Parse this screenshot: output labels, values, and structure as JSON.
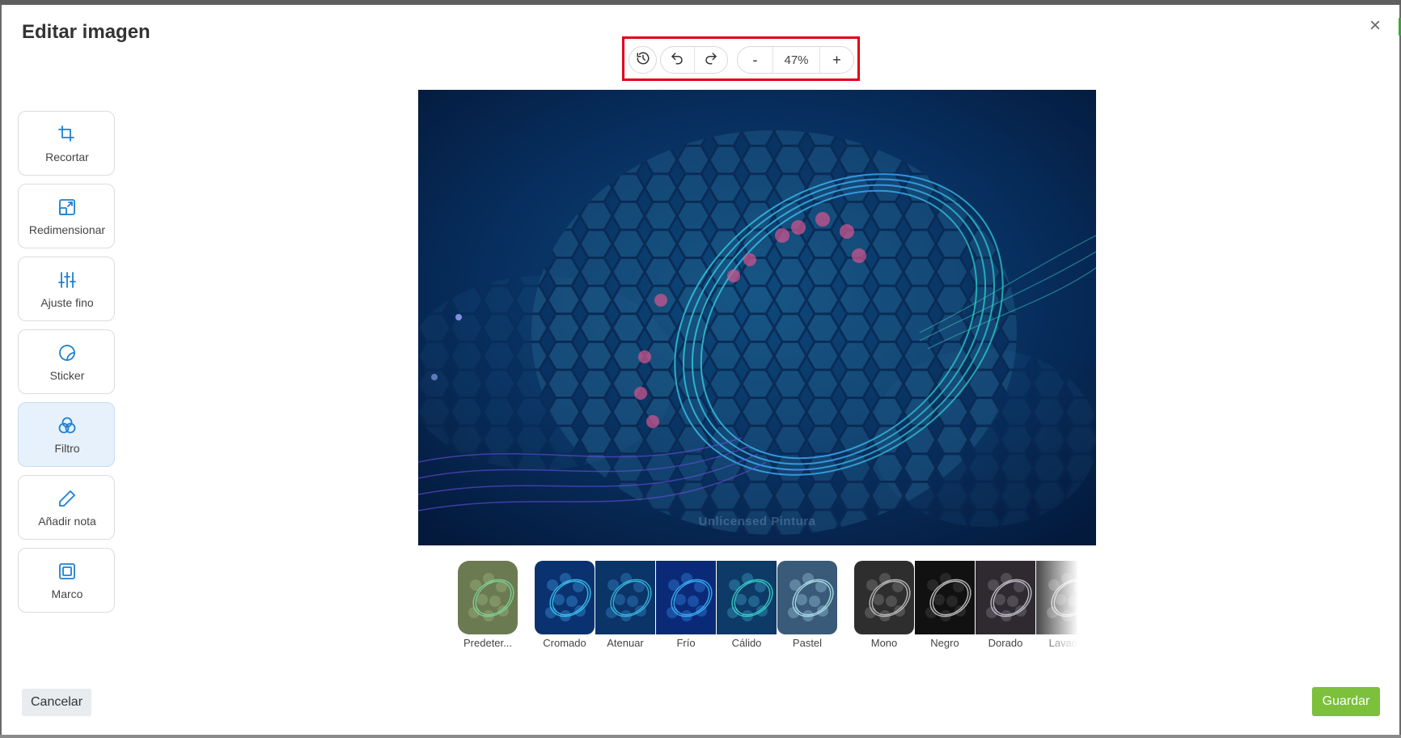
{
  "dialog": {
    "title": "Editar imagen",
    "close_glyph": "×"
  },
  "toolbar": {
    "zoom_value": "47%",
    "zoom_out_glyph": "-",
    "zoom_in_glyph": "+",
    "icons": [
      "history-icon",
      "undo-icon",
      "redo-icon"
    ],
    "highlight_color": "#e2001a"
  },
  "tools": [
    {
      "label": "Recortar",
      "icon": "crop-icon"
    },
    {
      "label": "Redimensionar",
      "icon": "resize-icon"
    },
    {
      "label": "Ajuste fino",
      "icon": "sliders-icon"
    },
    {
      "label": "Sticker",
      "icon": "sticker-icon"
    },
    {
      "label": "Filtro",
      "icon": "filter-icon",
      "active": true
    },
    {
      "label": "Añadir nota",
      "icon": "pencil-icon"
    },
    {
      "label": "Marco",
      "icon": "frame-icon"
    }
  ],
  "image": {
    "watermark": "Unlicensed Pintura"
  },
  "filters": [
    {
      "label": "Predeter..."
    },
    {
      "label": "Cromado"
    },
    {
      "label": "Atenuar"
    },
    {
      "label": "Frío"
    },
    {
      "label": "Cálido"
    },
    {
      "label": "Pastel"
    },
    {
      "label": "Mono"
    },
    {
      "label": "Negro"
    },
    {
      "label": "Dorado"
    },
    {
      "label": "Lavado"
    }
  ],
  "footer": {
    "cancel_label": "Cancelar",
    "save_label": "Guardar"
  },
  "colors": {
    "accent": "#1e80d1",
    "save": "#7cc03b",
    "active_tool_bg": "#e6f1fb"
  }
}
